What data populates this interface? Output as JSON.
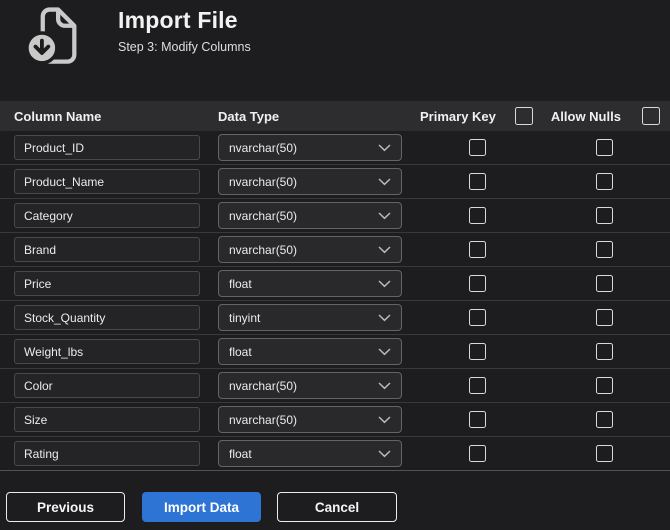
{
  "header": {
    "title": "Import File",
    "subtitle": "Step 3: Modify Columns",
    "icon": "file-download-icon"
  },
  "table": {
    "columns": [
      "Column Name",
      "Data Type",
      "Primary Key",
      "Allow Nulls"
    ],
    "select_all_primary_key_checked": false,
    "select_all_allow_nulls_checked": false,
    "rows": [
      {
        "name": "Product_ID",
        "type": "nvarchar(50)",
        "primary_key": false,
        "allow_nulls": false
      },
      {
        "name": "Product_Name",
        "type": "nvarchar(50)",
        "primary_key": false,
        "allow_nulls": false
      },
      {
        "name": "Category",
        "type": "nvarchar(50)",
        "primary_key": false,
        "allow_nulls": false
      },
      {
        "name": "Brand",
        "type": "nvarchar(50)",
        "primary_key": false,
        "allow_nulls": false
      },
      {
        "name": "Price",
        "type": "float",
        "primary_key": false,
        "allow_nulls": false
      },
      {
        "name": "Stock_Quantity",
        "type": "tinyint",
        "primary_key": false,
        "allow_nulls": false
      },
      {
        "name": "Weight_lbs",
        "type": "float",
        "primary_key": false,
        "allow_nulls": false
      },
      {
        "name": "Color",
        "type": "nvarchar(50)",
        "primary_key": false,
        "allow_nulls": false
      },
      {
        "name": "Size",
        "type": "nvarchar(50)",
        "primary_key": false,
        "allow_nulls": false
      },
      {
        "name": "Rating",
        "type": "float",
        "primary_key": false,
        "allow_nulls": false
      }
    ]
  },
  "footer": {
    "previous_label": "Previous",
    "import_label": "Import Data",
    "cancel_label": "Cancel"
  },
  "colors": {
    "background": "#1d1d1f",
    "table_header_bg": "#2d2d2f",
    "accent_blue": "#2e74d4",
    "input_bg": "#242427",
    "select_border": "#646468",
    "row_divider": "#39393b"
  }
}
